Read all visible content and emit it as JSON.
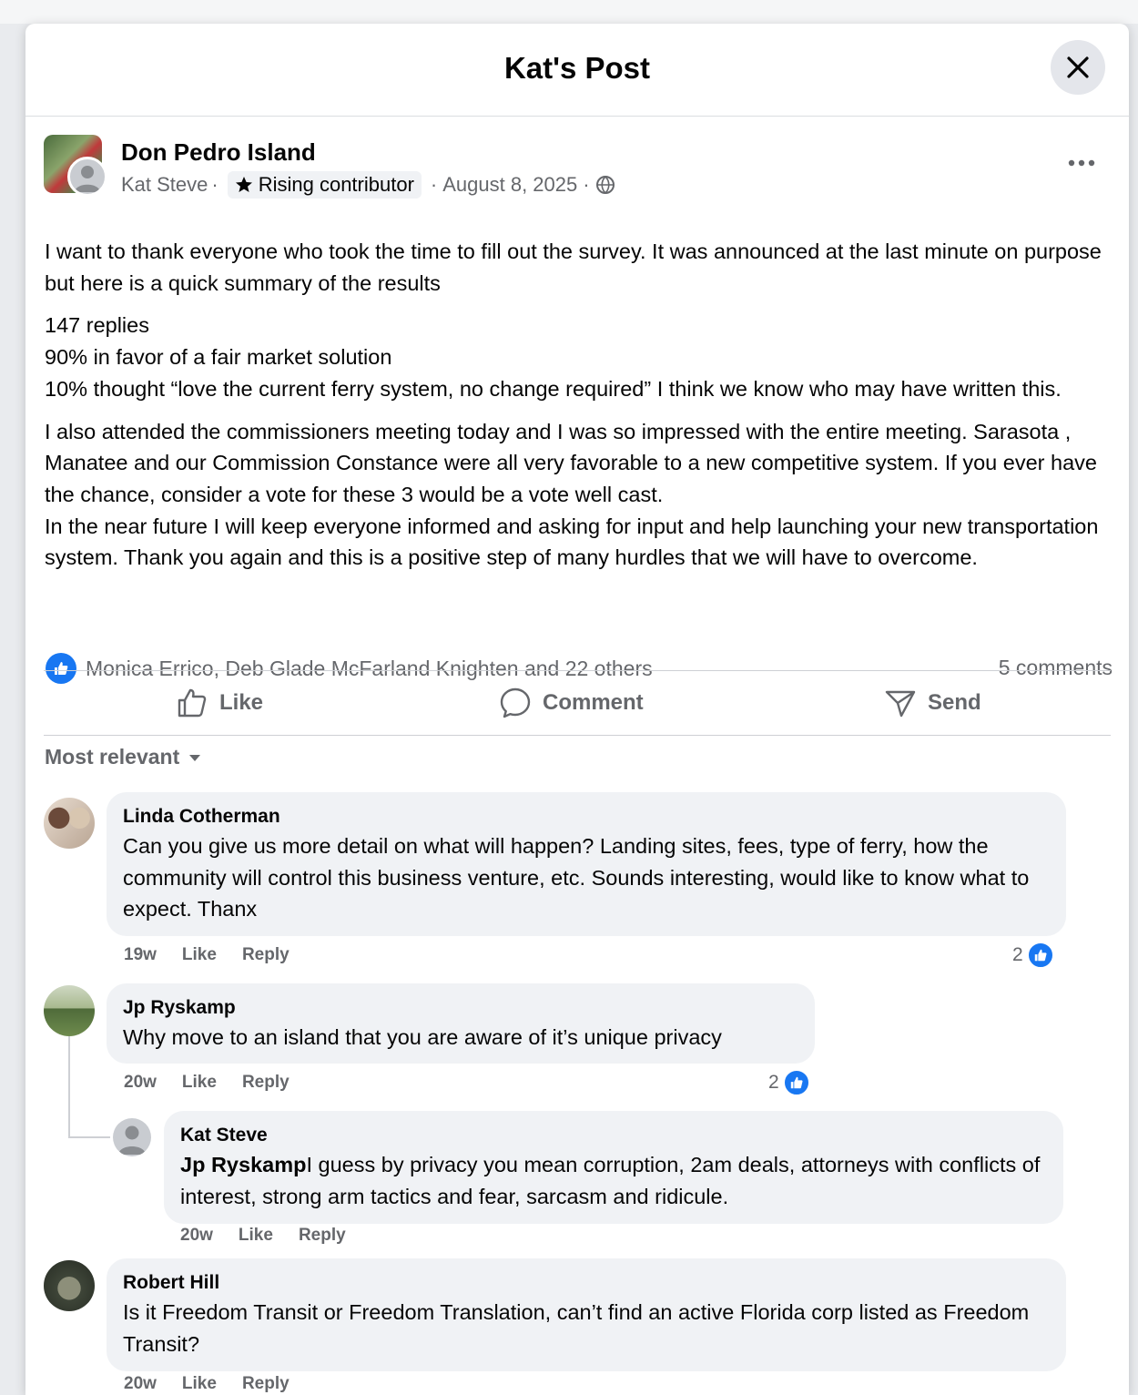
{
  "modal": {
    "title": "Kat's Post"
  },
  "post": {
    "group_name": "Don Pedro Island",
    "author": "Kat Steve",
    "dot1": "·",
    "badge": "Rising contributor",
    "dot2": "·",
    "date": "August 8, 2025",
    "dot3": "·",
    "paragraphs": [
      "I want to thank everyone who took the time to fill out the survey. It was announced at the last minute on purpose but here is a quick summary of the results",
      "147 replies\n90% in favor of a fair market solution\n10% thought “love the current ferry system, no change required” I think we know who may have written this.",
      "I also attended the commissioners meeting today and I was so impressed with the entire meeting. Sarasota , Manatee and our Commission Constance were all very favorable to a new competitive system. If you ever have the chance, consider a vote for these 3 would be a vote well cast.\nIn the near future I will keep everyone informed and asking for input and help launching your new transportation system. Thank you again and this is a positive step of many hurdles that we will have to overcome."
    ],
    "reactions_text": "Monica Errico, Deb Glade McFarland Knighten and 22 others",
    "comments_count": "5 comments"
  },
  "actions": {
    "like": "Like",
    "comment": "Comment",
    "send": "Send"
  },
  "sort_label": "Most relevant",
  "comments": [
    {
      "name": "Linda Cotherman",
      "text": "Can you give us more detail on what will happen? Landing sites, fees, type of ferry, how the community will control this business venture, etc. Sounds interesting, would like to know what to expect. Thanx",
      "time": "19w",
      "like": "Like",
      "reply": "Reply",
      "reactions": "2"
    },
    {
      "name": "Jp Ryskamp",
      "text": "Why move to an island that you are aware of it’s unique privacy",
      "time": "20w",
      "like": "Like",
      "reply": "Reply",
      "reactions": "2"
    },
    {
      "name": "Kat Steve",
      "mention": "Jp Ryskamp",
      "text": "I guess by privacy you mean corruption, 2am deals, attorneys with conflicts of interest, strong arm tactics and fear, sarcasm and ridicule.",
      "time": "20w",
      "like": "Like",
      "reply": "Reply"
    },
    {
      "name": "Robert Hill",
      "text": "Is it Freedom Transit or Freedom Translation, can’t find an active Florida corp listed as Freedom Transit?",
      "time": "20w",
      "like": "Like",
      "reply": "Reply"
    }
  ],
  "colors": {
    "accent": "#1877f2",
    "bubble": "#f0f2f5",
    "secondary_text": "#65676b"
  }
}
